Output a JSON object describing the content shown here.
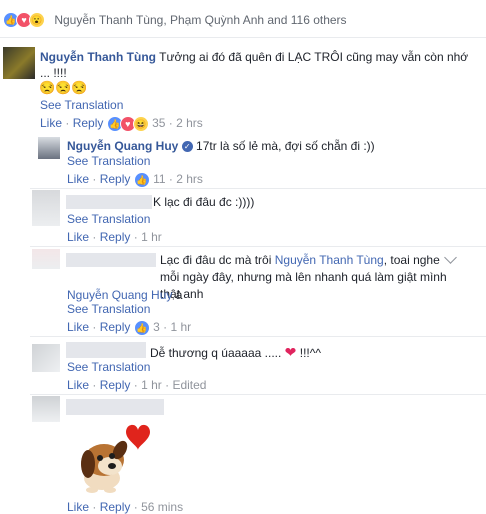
{
  "reactions_bar": {
    "names": "Nguyễn Thanh Tùng, Phạm Quỳnh Anh and 116 others"
  },
  "comments": [
    {
      "author": "Nguyễn Thanh Tùng",
      "text": "Tưởng ai đó đã quên đi LẠC TRÔI cũng may vẫn còn nhớ ... !!!!",
      "emoji_line": "😒😒😒",
      "see_translation": "See Translation",
      "like": "Like",
      "reply": "Reply",
      "count": "35",
      "time": "2 hrs"
    },
    {
      "author": "Nguyễn Quang Huy",
      "text": "17tr là số lẻ mà, đợi số chẵn đi :))",
      "see_translation": "See Translation",
      "like": "Like",
      "reply": "Reply",
      "count": "11",
      "time": "2 hrs"
    },
    {
      "text": "K lạc đi đâu đc :))))",
      "see_translation": "See Translation",
      "like": "Like",
      "reply": "Reply",
      "time": "1 hr"
    },
    {
      "text_before": "Lạc đi đâu dc mà trôi ",
      "mention1": "Nguyễn Thanh Tùng",
      "text_after": ", toai nghe mỗi ngày đây, nhưng mà lên nhanh quá làm giật mình thật anh",
      "mention2": "Nguyễn Quang Huy",
      "text_end": " à",
      "see_translation": "See Translation",
      "like": "Like",
      "reply": "Reply",
      "count": "3",
      "time": "1 hr"
    },
    {
      "text": "Dễ thương q úaaaaa .....",
      "text_end": " !!!^^",
      "see_translation": "See Translation",
      "like": "Like",
      "reply": "Reply",
      "time": "1 hr",
      "edited": "Edited"
    },
    {
      "like": "Like",
      "reply": "Reply",
      "time": "56 mins"
    }
  ],
  "sep": "·",
  "colors": {
    "link": "#4267b2",
    "name": "#365899",
    "meta": "#90949c",
    "heart": "#f25268"
  }
}
